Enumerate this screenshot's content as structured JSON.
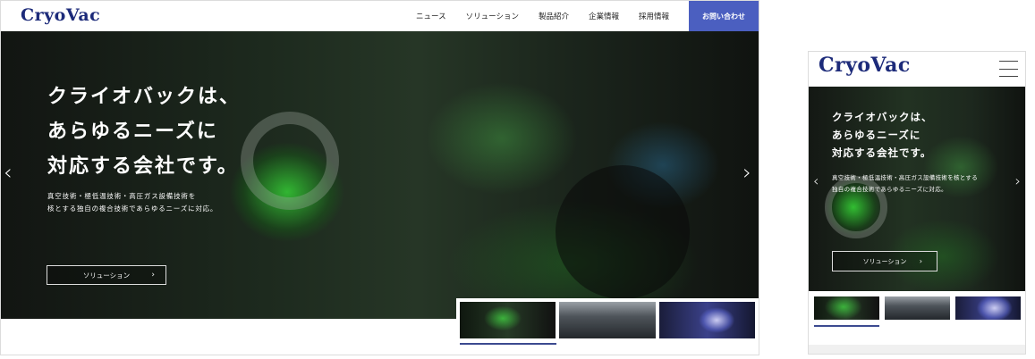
{
  "brand": {
    "logo": "CryoVac",
    "color": "#1d2b7a",
    "accent": "#4b5fc0"
  },
  "nav": {
    "items": [
      "ニュース",
      "ソリューション",
      "製品紹介",
      "企業情報",
      "採用情報"
    ],
    "contact": "お問い合わせ"
  },
  "hero": {
    "headline": "クライオバックは、\nあらゆるニーズに\n対応する会社です。",
    "subtext": "真空技術・極低温技術・高圧ガス設備技術を\n核とする独自の複合技術であらゆるニーズに対応。",
    "button": "ソリューション",
    "chevron": "›",
    "prev_icon": "‹",
    "next_icon": "›"
  },
  "mobile": {
    "headline": "クライオバックは、\nあらゆるニーズに\n対応する会社です。",
    "subtext": "真空技術・極低温技術・高圧ガス設備技術を核とする\n独自の複合技術であらゆるニーズに対応。",
    "button": "ソリューション",
    "menu_icon": "hamburger-icon"
  },
  "thumbnails": {
    "active_index": 0,
    "count": 3
  }
}
